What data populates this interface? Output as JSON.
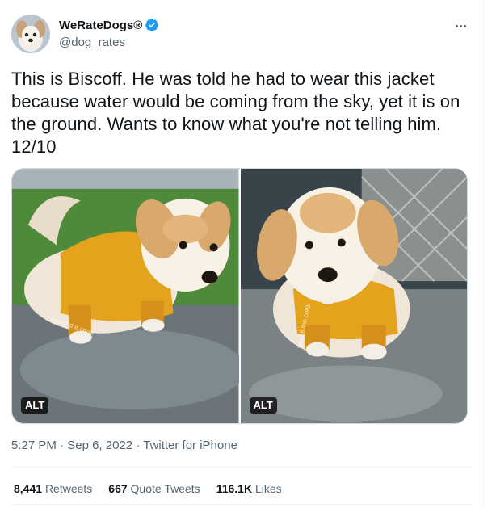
{
  "author": {
    "display_name": "WeRateDogs®",
    "handle": "@dog_rates",
    "verified": true
  },
  "tweet": {
    "text": "This is Biscoff. He was told he had to wear this jacket because water would be coming from the sky, yet it is on the ground. Wants to know what you're not telling him. 12/10"
  },
  "media": [
    {
      "alt_label": "ALT",
      "watermark": "biscoff.the.corgi"
    },
    {
      "alt_label": "ALT",
      "watermark": "biscoff.the.corgi"
    }
  ],
  "meta": {
    "time": "5:27 PM",
    "sep1": " · ",
    "date": "Sep 6, 2022",
    "sep2": " · ",
    "source": "Twitter for iPhone"
  },
  "stats": {
    "retweets": {
      "count": "8,441",
      "label": "Retweets"
    },
    "quotes": {
      "count": "667",
      "label": "Quote Tweets"
    },
    "likes": {
      "count": "116.1K",
      "label": "Likes"
    }
  },
  "colors": {
    "accent": "#1d9bf0",
    "text": "#0f1419",
    "secondary": "#536471",
    "jacket": "#e3a31c"
  },
  "icons": {
    "verified": "verified-badge-icon",
    "more": "more-options-icon"
  }
}
